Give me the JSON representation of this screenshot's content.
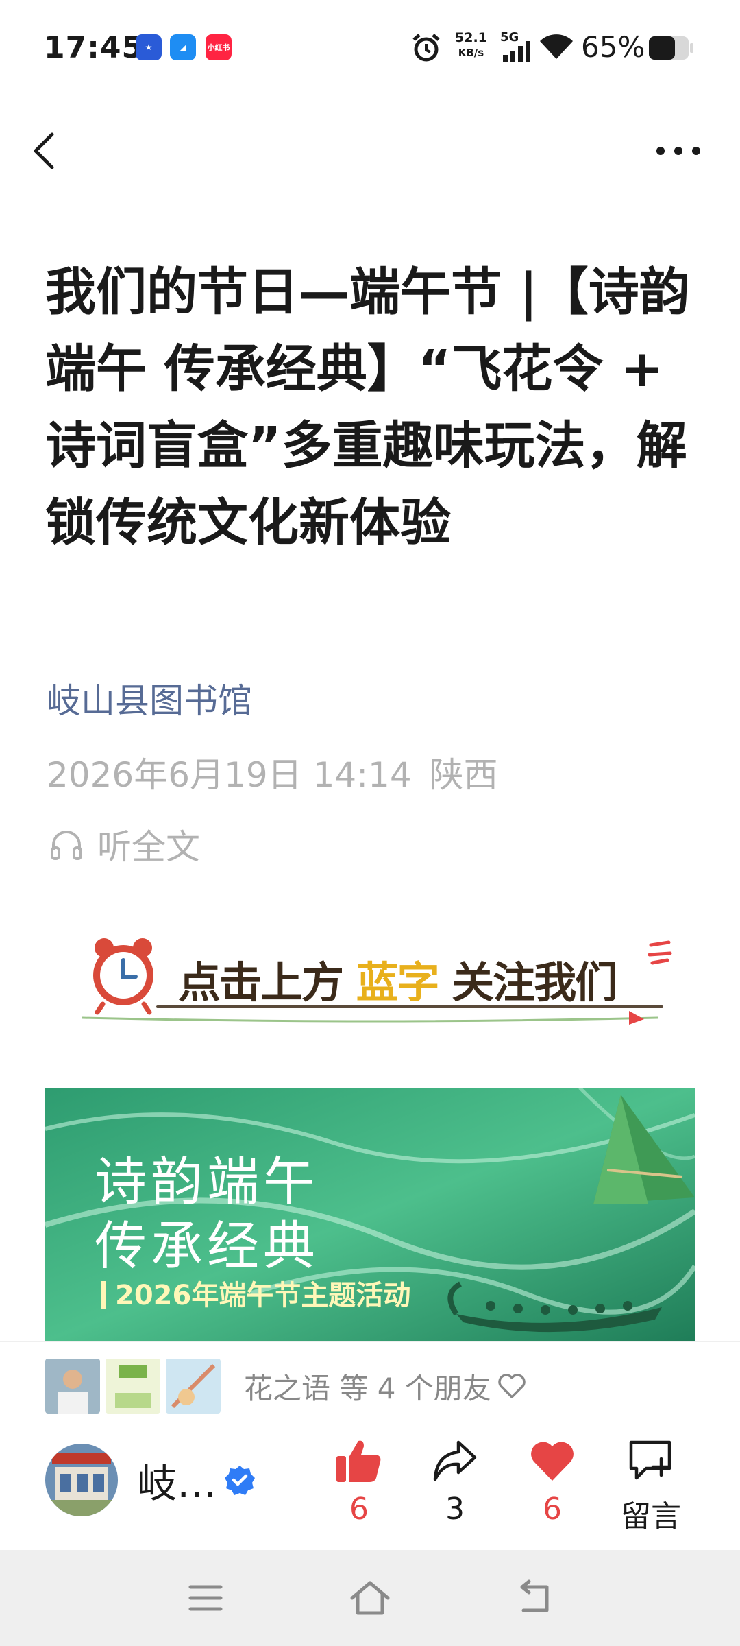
{
  "status_bar": {
    "time": "17:45",
    "apps": [
      "app-icon-1",
      "app-icon-2",
      "小红书"
    ],
    "net_speed_value": "52.1",
    "net_speed_unit": "KB/s",
    "network": "5G",
    "battery": "65%"
  },
  "article": {
    "title": "我们的节日—端午节 |【诗韵端午 传承经典】“飞花令 + 诗词盲盒”多重趣味玩法，解锁传统文化新体验",
    "author": "岐山县图书馆",
    "date": "2026年6月19日 14:14",
    "location": "陕西",
    "listen_label": "听全文"
  },
  "follow_banner": {
    "before": "点击上方",
    "highlight": "蓝字",
    "after": "关注我们"
  },
  "cover": {
    "title_line1": "诗韵端午",
    "title_line2": "传承经典",
    "subtitle": "2026年端午节主题活动"
  },
  "bottom_bar": {
    "friends_text": "花之语 等 4 个朋友",
    "account_name": "岐…",
    "like_count": "6",
    "share_count": "3",
    "fav_count": "6",
    "comment_label": "留言"
  },
  "colors": {
    "link_blue": "#576b95",
    "meta_gray": "#b2b2b2",
    "accent_red": "#e64545",
    "verified_blue": "#2f7cf6"
  }
}
